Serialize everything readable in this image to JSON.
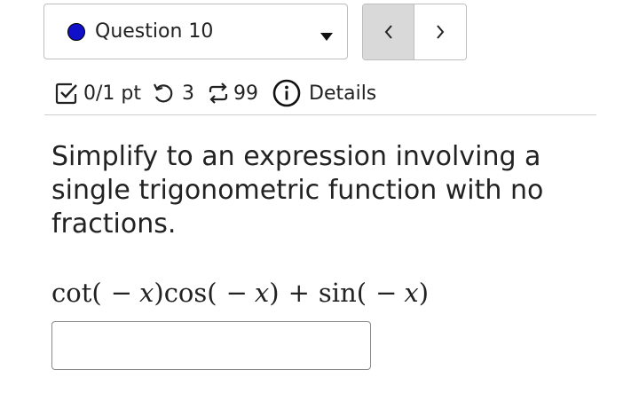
{
  "question_selector": {
    "label": "Question 10",
    "status_color": "#1010c8"
  },
  "navigation": {
    "prev_icon": "chevron-left",
    "next_icon": "chevron-right"
  },
  "meta": {
    "points": "0/1 pt",
    "attempts": "3",
    "versions": "99",
    "details": "Details"
  },
  "question": {
    "prompt": "Simplify to an expression involving a single trigonometric function with no fractions.",
    "expression": {
      "cot": "cot",
      "cos": "cos",
      "sin": "sin",
      "var": "x",
      "minus": "−",
      "plus": "+"
    }
  },
  "answer": {
    "value": ""
  }
}
